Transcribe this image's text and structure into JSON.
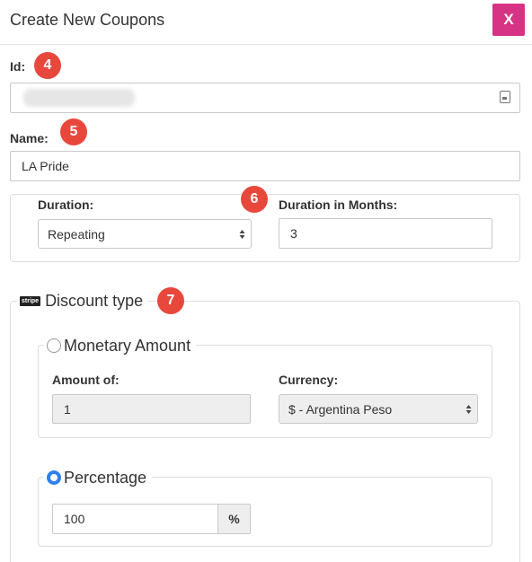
{
  "modal": {
    "title": "Create New Coupons",
    "close_label": "X"
  },
  "badges": [
    "4",
    "5",
    "6",
    "7"
  ],
  "id_field": {
    "label": "Id:",
    "value": ""
  },
  "name_field": {
    "label": "Name:",
    "value": "LA Pride"
  },
  "duration": {
    "label": "Duration:",
    "selected": "Repeating",
    "months_label": "Duration in Months:",
    "months_value": "3"
  },
  "discount": {
    "legend": "Discount type",
    "stripe_badge": "stripe",
    "monetary": {
      "label": "Monetary Amount",
      "checked": false,
      "amount_label": "Amount of:",
      "amount_value": "1",
      "currency_label": "Currency:",
      "currency_selected": "$ - Argentina Peso"
    },
    "percentage": {
      "label": "Percentage",
      "checked": true,
      "value": "100",
      "suffix": "%"
    }
  },
  "colors": {
    "close_button": "#d63384",
    "badge": "#e8473b",
    "radio_checked": "#2f80ed"
  }
}
